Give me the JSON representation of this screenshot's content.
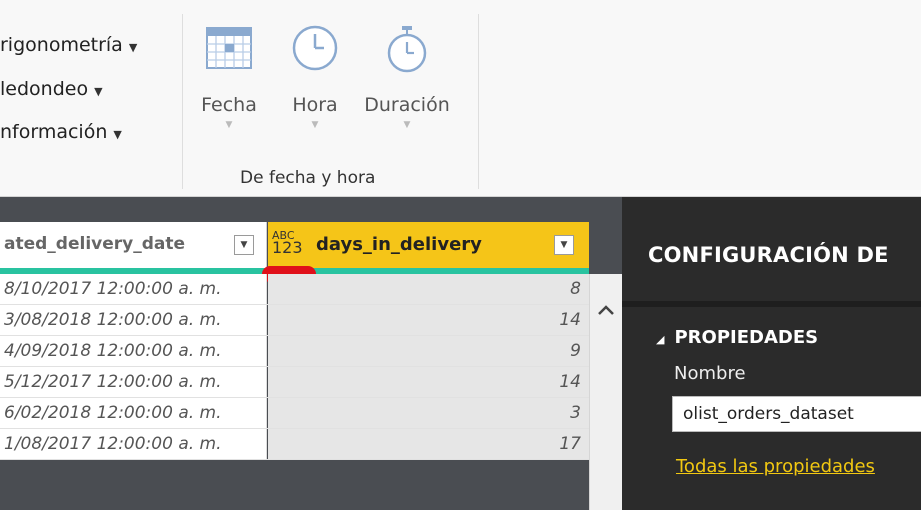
{
  "ribbon": {
    "commands": [
      {
        "label": "rigonometría",
        "dropdown": "▼"
      },
      {
        "label": "ledondeo",
        "dropdown": "▼"
      },
      {
        "label": "nformación",
        "dropdown": "▼"
      }
    ],
    "datetime_group": {
      "label": "De fecha y hora",
      "buttons": [
        {
          "label": "Fecha",
          "icon": "calendar-icon"
        },
        {
          "label": "Hora",
          "icon": "clock-icon"
        },
        {
          "label": "Duración",
          "icon": "stopwatch-icon"
        }
      ],
      "dropdown": "▼"
    }
  },
  "grid": {
    "columns": [
      {
        "title": "ated_delivery_date",
        "filter": "▼"
      },
      {
        "title": "days_in_delivery",
        "filter": "▼",
        "type_badge_top": "ABC",
        "type_badge_bottom": "123"
      }
    ],
    "rows": [
      {
        "date": "8/10/2017 12:00:00 a. m.",
        "days": "8"
      },
      {
        "date": "3/08/2018 12:00:00 a. m.",
        "days": "14"
      },
      {
        "date": "4/09/2018 12:00:00 a. m.",
        "days": "9"
      },
      {
        "date": "5/12/2017 12:00:00 a. m.",
        "days": "14"
      },
      {
        "date": "6/02/2018 12:00:00 a. m.",
        "days": "3"
      },
      {
        "date": "1/08/2017 12:00:00 a. m.",
        "days": "17"
      }
    ]
  },
  "settings": {
    "title": "CONFIGURACIÓN DE",
    "properties_header": "PROPIEDADES",
    "toggle": "◢",
    "name_label": "Nombre",
    "name_value": "olist_orders_dataset",
    "all_properties_link": "Todas las propiedades"
  },
  "colors": {
    "accent_yellow": "#f5c518",
    "quality_green": "#29c3a0",
    "marker_red": "#e0101a",
    "panel_dark": "#2b2b2b",
    "link_yellow": "#f2c811"
  }
}
